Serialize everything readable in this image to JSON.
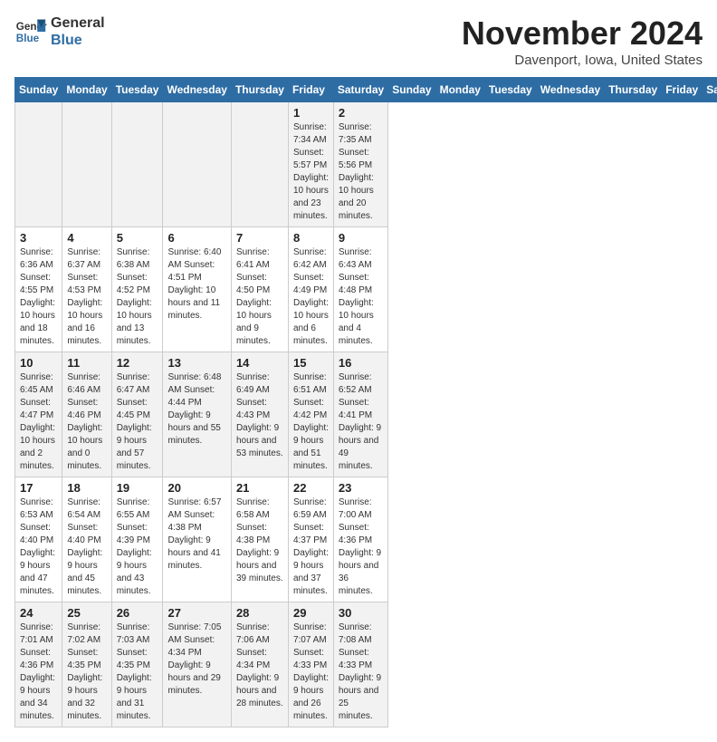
{
  "header": {
    "logo_line1": "General",
    "logo_line2": "Blue",
    "month_title": "November 2024",
    "location": "Davenport, Iowa, United States"
  },
  "days_of_week": [
    "Sunday",
    "Monday",
    "Tuesday",
    "Wednesday",
    "Thursday",
    "Friday",
    "Saturday"
  ],
  "weeks": [
    [
      {
        "day": "",
        "info": ""
      },
      {
        "day": "",
        "info": ""
      },
      {
        "day": "",
        "info": ""
      },
      {
        "day": "",
        "info": ""
      },
      {
        "day": "",
        "info": ""
      },
      {
        "day": "1",
        "info": "Sunrise: 7:34 AM\nSunset: 5:57 PM\nDaylight: 10 hours and 23 minutes."
      },
      {
        "day": "2",
        "info": "Sunrise: 7:35 AM\nSunset: 5:56 PM\nDaylight: 10 hours and 20 minutes."
      }
    ],
    [
      {
        "day": "3",
        "info": "Sunrise: 6:36 AM\nSunset: 4:55 PM\nDaylight: 10 hours and 18 minutes."
      },
      {
        "day": "4",
        "info": "Sunrise: 6:37 AM\nSunset: 4:53 PM\nDaylight: 10 hours and 16 minutes."
      },
      {
        "day": "5",
        "info": "Sunrise: 6:38 AM\nSunset: 4:52 PM\nDaylight: 10 hours and 13 minutes."
      },
      {
        "day": "6",
        "info": "Sunrise: 6:40 AM\nSunset: 4:51 PM\nDaylight: 10 hours and 11 minutes."
      },
      {
        "day": "7",
        "info": "Sunrise: 6:41 AM\nSunset: 4:50 PM\nDaylight: 10 hours and 9 minutes."
      },
      {
        "day": "8",
        "info": "Sunrise: 6:42 AM\nSunset: 4:49 PM\nDaylight: 10 hours and 6 minutes."
      },
      {
        "day": "9",
        "info": "Sunrise: 6:43 AM\nSunset: 4:48 PM\nDaylight: 10 hours and 4 minutes."
      }
    ],
    [
      {
        "day": "10",
        "info": "Sunrise: 6:45 AM\nSunset: 4:47 PM\nDaylight: 10 hours and 2 minutes."
      },
      {
        "day": "11",
        "info": "Sunrise: 6:46 AM\nSunset: 4:46 PM\nDaylight: 10 hours and 0 minutes."
      },
      {
        "day": "12",
        "info": "Sunrise: 6:47 AM\nSunset: 4:45 PM\nDaylight: 9 hours and 57 minutes."
      },
      {
        "day": "13",
        "info": "Sunrise: 6:48 AM\nSunset: 4:44 PM\nDaylight: 9 hours and 55 minutes."
      },
      {
        "day": "14",
        "info": "Sunrise: 6:49 AM\nSunset: 4:43 PM\nDaylight: 9 hours and 53 minutes."
      },
      {
        "day": "15",
        "info": "Sunrise: 6:51 AM\nSunset: 4:42 PM\nDaylight: 9 hours and 51 minutes."
      },
      {
        "day": "16",
        "info": "Sunrise: 6:52 AM\nSunset: 4:41 PM\nDaylight: 9 hours and 49 minutes."
      }
    ],
    [
      {
        "day": "17",
        "info": "Sunrise: 6:53 AM\nSunset: 4:40 PM\nDaylight: 9 hours and 47 minutes."
      },
      {
        "day": "18",
        "info": "Sunrise: 6:54 AM\nSunset: 4:40 PM\nDaylight: 9 hours and 45 minutes."
      },
      {
        "day": "19",
        "info": "Sunrise: 6:55 AM\nSunset: 4:39 PM\nDaylight: 9 hours and 43 minutes."
      },
      {
        "day": "20",
        "info": "Sunrise: 6:57 AM\nSunset: 4:38 PM\nDaylight: 9 hours and 41 minutes."
      },
      {
        "day": "21",
        "info": "Sunrise: 6:58 AM\nSunset: 4:38 PM\nDaylight: 9 hours and 39 minutes."
      },
      {
        "day": "22",
        "info": "Sunrise: 6:59 AM\nSunset: 4:37 PM\nDaylight: 9 hours and 37 minutes."
      },
      {
        "day": "23",
        "info": "Sunrise: 7:00 AM\nSunset: 4:36 PM\nDaylight: 9 hours and 36 minutes."
      }
    ],
    [
      {
        "day": "24",
        "info": "Sunrise: 7:01 AM\nSunset: 4:36 PM\nDaylight: 9 hours and 34 minutes."
      },
      {
        "day": "25",
        "info": "Sunrise: 7:02 AM\nSunset: 4:35 PM\nDaylight: 9 hours and 32 minutes."
      },
      {
        "day": "26",
        "info": "Sunrise: 7:03 AM\nSunset: 4:35 PM\nDaylight: 9 hours and 31 minutes."
      },
      {
        "day": "27",
        "info": "Sunrise: 7:05 AM\nSunset: 4:34 PM\nDaylight: 9 hours and 29 minutes."
      },
      {
        "day": "28",
        "info": "Sunrise: 7:06 AM\nSunset: 4:34 PM\nDaylight: 9 hours and 28 minutes."
      },
      {
        "day": "29",
        "info": "Sunrise: 7:07 AM\nSunset: 4:33 PM\nDaylight: 9 hours and 26 minutes."
      },
      {
        "day": "30",
        "info": "Sunrise: 7:08 AM\nSunset: 4:33 PM\nDaylight: 9 hours and 25 minutes."
      }
    ]
  ]
}
